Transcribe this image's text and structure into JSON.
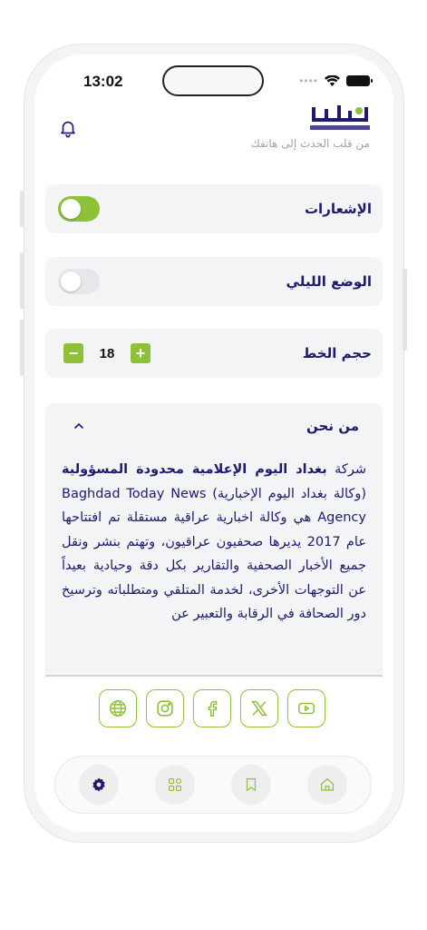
{
  "status_bar": {
    "time": "13:02"
  },
  "header": {
    "logo_text": "BAGHDADTODAY.NEWS",
    "tagline": "من قلب الحدث إلى هاتفك"
  },
  "settings": {
    "notifications": {
      "label": "الإشعارات",
      "enabled": true
    },
    "night_mode": {
      "label": "الوضع الليلي",
      "enabled": false
    },
    "font_size": {
      "label": "حجم الخط",
      "value": "18",
      "minus": "−",
      "plus": "+"
    }
  },
  "about": {
    "title": "من نحن",
    "intro": "شركة ",
    "company_bold": "بغداد اليوم الإعلامية محدودة المسؤولية",
    "text": " (وكالة بغداد اليوم الإخبارية) Baghdad Today News Agency هي وكالة اخبارية عراقية مستقلة تم افتتاحها عام 2017 يديرها صحفيون عراقيون، وتهتم بنشر ونقل جميع الأخبار الصحفية والتقارير بكل دقة وحيادية بعيداً عن التوجهات الأخرى، لخدمة المتلقي ومتطلباته وترسيخ دور الصحافة في الرقابة والتعبير عن"
  },
  "social": [
    "web-icon",
    "instagram-icon",
    "facebook-icon",
    "x-icon",
    "youtube-icon"
  ],
  "nav": [
    "settings-icon",
    "grid-icon",
    "bookmark-icon",
    "home-icon"
  ],
  "colors": {
    "accent": "#8fc03a",
    "brand": "#1e1b6e"
  }
}
